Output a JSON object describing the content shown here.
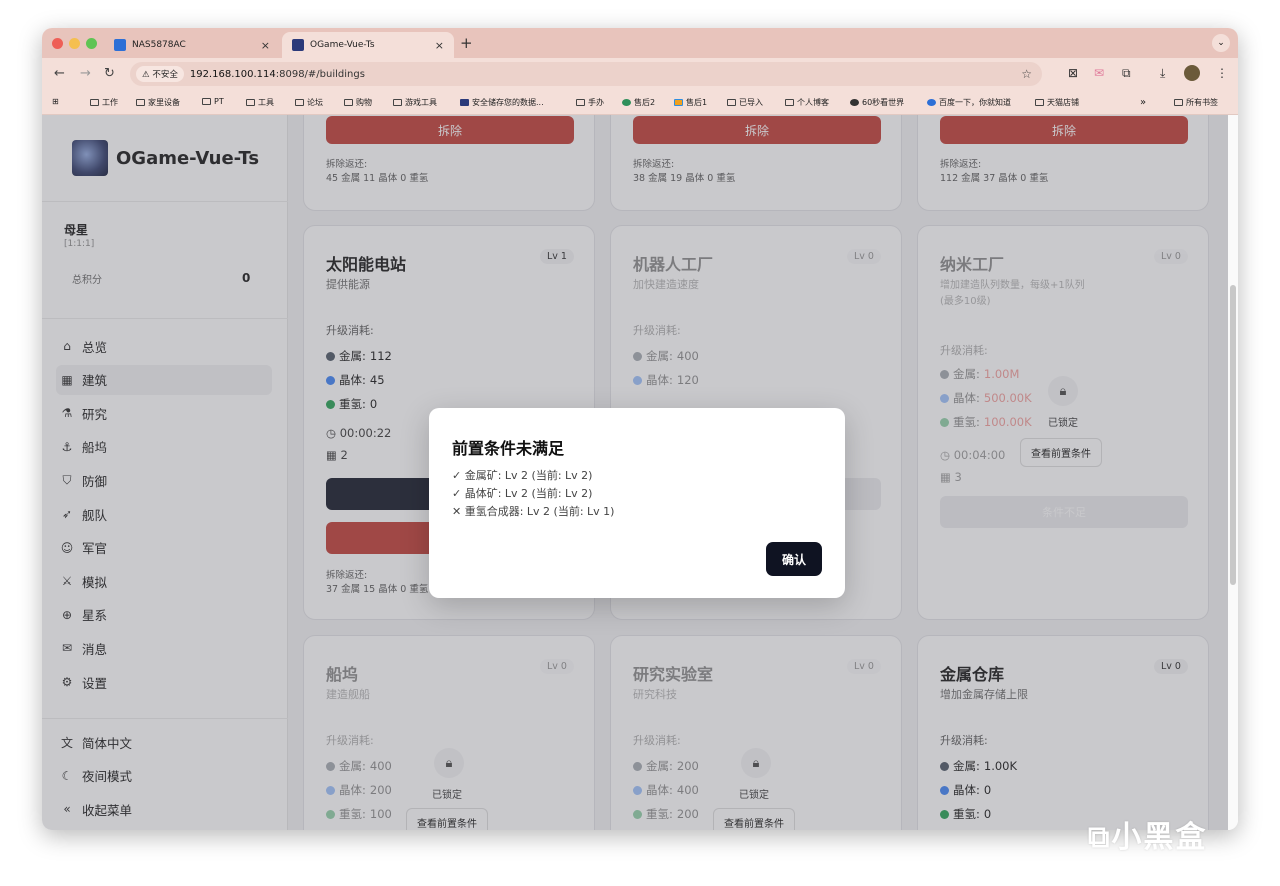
{
  "browser": {
    "tabs": [
      {
        "title": "NAS5878AC",
        "close": "×"
      },
      {
        "title": "OGame-Vue-Ts",
        "close": "×"
      }
    ],
    "new_tab": "+",
    "security_label": "不安全",
    "url_host": "192.168.100.114",
    "url_rest": ":8098/#/buildings",
    "bookmarks": [
      "工作",
      "家里设备",
      "PT",
      "工具",
      "论坛",
      "购物",
      "游戏工具",
      "安全储存您的数据...",
      "手办",
      "售后2",
      "售后1",
      "已导入",
      "个人博客",
      "60秒看世界",
      "百度一下，你就知道",
      "天猫店铺"
    ],
    "bookmarks_more": "»",
    "all_bookmarks": "所有书签"
  },
  "sidebar": {
    "brand": "OGame-Vue-Ts",
    "planet_name": "母星",
    "planet_coords": "[1:1:1]",
    "score_label": "总积分",
    "score_value": "0",
    "menu": [
      {
        "label": "总览",
        "icon": "home-icon",
        "glyph": "⌂"
      },
      {
        "label": "建筑",
        "icon": "building-icon",
        "glyph": "▦"
      },
      {
        "label": "研究",
        "icon": "flask-icon",
        "glyph": "⚗"
      },
      {
        "label": "船坞",
        "icon": "dock-icon",
        "glyph": "⚓"
      },
      {
        "label": "防御",
        "icon": "shield-icon",
        "glyph": "⛉"
      },
      {
        "label": "舰队",
        "icon": "rocket-icon",
        "glyph": "➶"
      },
      {
        "label": "军官",
        "icon": "users-icon",
        "glyph": "☺"
      },
      {
        "label": "模拟",
        "icon": "swords-icon",
        "glyph": "⚔"
      },
      {
        "label": "星系",
        "icon": "globe-icon",
        "glyph": "⊕"
      },
      {
        "label": "消息",
        "icon": "mail-icon",
        "glyph": "✉"
      },
      {
        "label": "设置",
        "icon": "gear-icon",
        "glyph": "⚙"
      }
    ],
    "bottom": [
      {
        "label": "简体中文",
        "icon": "language-icon",
        "glyph": "文"
      },
      {
        "label": "夜间模式",
        "icon": "moon-icon",
        "glyph": "☾"
      },
      {
        "label": "收起菜单",
        "icon": "collapse-icon",
        "glyph": "«"
      }
    ]
  },
  "labels": {
    "demolish": "拆除",
    "demolish_return": "拆除返还:",
    "upgrade_cost": "升级消耗:",
    "metal": "金属:",
    "crystal": "晶体:",
    "deuterium": "重氢:",
    "locked": "已锁定",
    "view_prereq": "查看前置条件"
  },
  "top_row_returns": [
    "45 金属  11 晶体  0 重氢",
    "38 金属  19 晶体  0 重氢",
    "112 金属  37 晶体  0 重氢"
  ],
  "cards": {
    "solar": {
      "title": "太阳能电站",
      "desc": "提供能源",
      "level": "Lv 1",
      "metal": "112",
      "crystal": "45",
      "deuterium": "0",
      "time": "00:00:22",
      "fields": "2",
      "return": "37 金属  15 晶体  0 重氢"
    },
    "robot": {
      "title": "机器人工厂",
      "desc": "加快建造速度",
      "level": "Lv 0",
      "metal": "400",
      "crystal": "120"
    },
    "nanite": {
      "title": "纳米工厂",
      "desc": "增加建造队列数量，每级+1队列",
      "desc2": "(最多10级)",
      "level": "Lv 0",
      "metal": "1.00M",
      "crystal": "500.00K",
      "deuterium": "100.00K",
      "time": "00:04:00",
      "fields": "3",
      "button": "条件不足"
    },
    "shipyard": {
      "title": "船坞",
      "desc": "建造舰船",
      "level": "Lv 0",
      "metal": "400",
      "crystal": "200",
      "deuterium": "100"
    },
    "lab": {
      "title": "研究实验室",
      "desc": "研究科技",
      "level": "Lv 0",
      "metal": "200",
      "crystal": "400",
      "deuterium": "200"
    },
    "metal_storage": {
      "title": "金属仓库",
      "desc": "增加金属存储上限",
      "level": "Lv 0",
      "metal": "1.00K",
      "crystal": "0",
      "deuterium": "0"
    }
  },
  "colors": {
    "metal": "#4b5563",
    "crystal": "#3b82f6",
    "deuterium": "#22a050",
    "danger": "#c03a32",
    "primary": "#0f1322"
  },
  "modal": {
    "title": "前置条件未满足",
    "lines": [
      "✓ 金属矿: Lv 2 (当前: Lv 2)",
      "✓ 晶体矿: Lv 2 (当前: Lv 2)",
      "✕ 重氢合成器: Lv 2 (当前: Lv 1)"
    ],
    "confirm": "确认"
  },
  "watermark": "小黑盒"
}
